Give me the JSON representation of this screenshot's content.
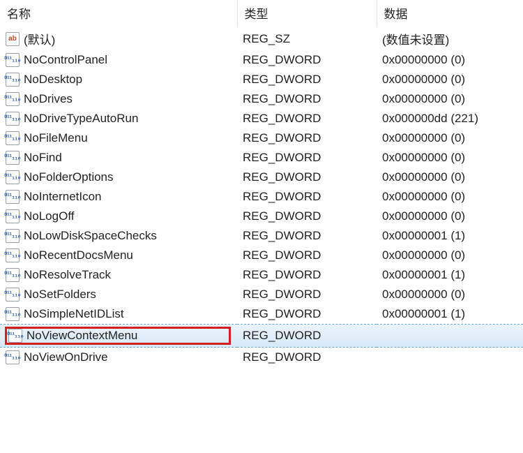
{
  "columns": {
    "name": "名称",
    "type": "类型",
    "data": "数据"
  },
  "icons": {
    "sz": "ab",
    "dword": "011\n110"
  },
  "rows": [
    {
      "icon": "sz",
      "name": "(默认)",
      "type": "REG_SZ",
      "data": "(数值未设置)",
      "selected": false,
      "highlighted": false
    },
    {
      "icon": "dword",
      "name": "NoControlPanel",
      "type": "REG_DWORD",
      "data": "0x00000000 (0)",
      "selected": false,
      "highlighted": false
    },
    {
      "icon": "dword",
      "name": "NoDesktop",
      "type": "REG_DWORD",
      "data": "0x00000000 (0)",
      "selected": false,
      "highlighted": false
    },
    {
      "icon": "dword",
      "name": "NoDrives",
      "type": "REG_DWORD",
      "data": "0x00000000 (0)",
      "selected": false,
      "highlighted": false
    },
    {
      "icon": "dword",
      "name": "NoDriveTypeAutoRun",
      "type": "REG_DWORD",
      "data": "0x000000dd (221)",
      "selected": false,
      "highlighted": false
    },
    {
      "icon": "dword",
      "name": "NoFileMenu",
      "type": "REG_DWORD",
      "data": "0x00000000 (0)",
      "selected": false,
      "highlighted": false
    },
    {
      "icon": "dword",
      "name": "NoFind",
      "type": "REG_DWORD",
      "data": "0x00000000 (0)",
      "selected": false,
      "highlighted": false
    },
    {
      "icon": "dword",
      "name": "NoFolderOptions",
      "type": "REG_DWORD",
      "data": "0x00000000 (0)",
      "selected": false,
      "highlighted": false
    },
    {
      "icon": "dword",
      "name": "NoInternetIcon",
      "type": "REG_DWORD",
      "data": "0x00000000 (0)",
      "selected": false,
      "highlighted": false
    },
    {
      "icon": "dword",
      "name": "NoLogOff",
      "type": "REG_DWORD",
      "data": "0x00000000 (0)",
      "selected": false,
      "highlighted": false
    },
    {
      "icon": "dword",
      "name": "NoLowDiskSpaceChecks",
      "type": "REG_DWORD",
      "data": "0x00000001 (1)",
      "selected": false,
      "highlighted": false
    },
    {
      "icon": "dword",
      "name": "NoRecentDocsMenu",
      "type": "REG_DWORD",
      "data": "0x00000000 (0)",
      "selected": false,
      "highlighted": false
    },
    {
      "icon": "dword",
      "name": "NoResolveTrack",
      "type": "REG_DWORD",
      "data": "0x00000001 (1)",
      "selected": false,
      "highlighted": false
    },
    {
      "icon": "dword",
      "name": "NoSetFolders",
      "type": "REG_DWORD",
      "data": "0x00000000 (0)",
      "selected": false,
      "highlighted": false
    },
    {
      "icon": "dword",
      "name": "NoSimpleNetIDList",
      "type": "REG_DWORD",
      "data": "0x00000001 (1)",
      "selected": false,
      "highlighted": false
    },
    {
      "icon": "dword",
      "name": "NoViewContextMenu",
      "type": "REG_DWORD",
      "data": "",
      "selected": true,
      "highlighted": true
    },
    {
      "icon": "dword",
      "name": "NoViewOnDrive",
      "type": "REG_DWORD",
      "data": "",
      "selected": false,
      "highlighted": false
    }
  ]
}
